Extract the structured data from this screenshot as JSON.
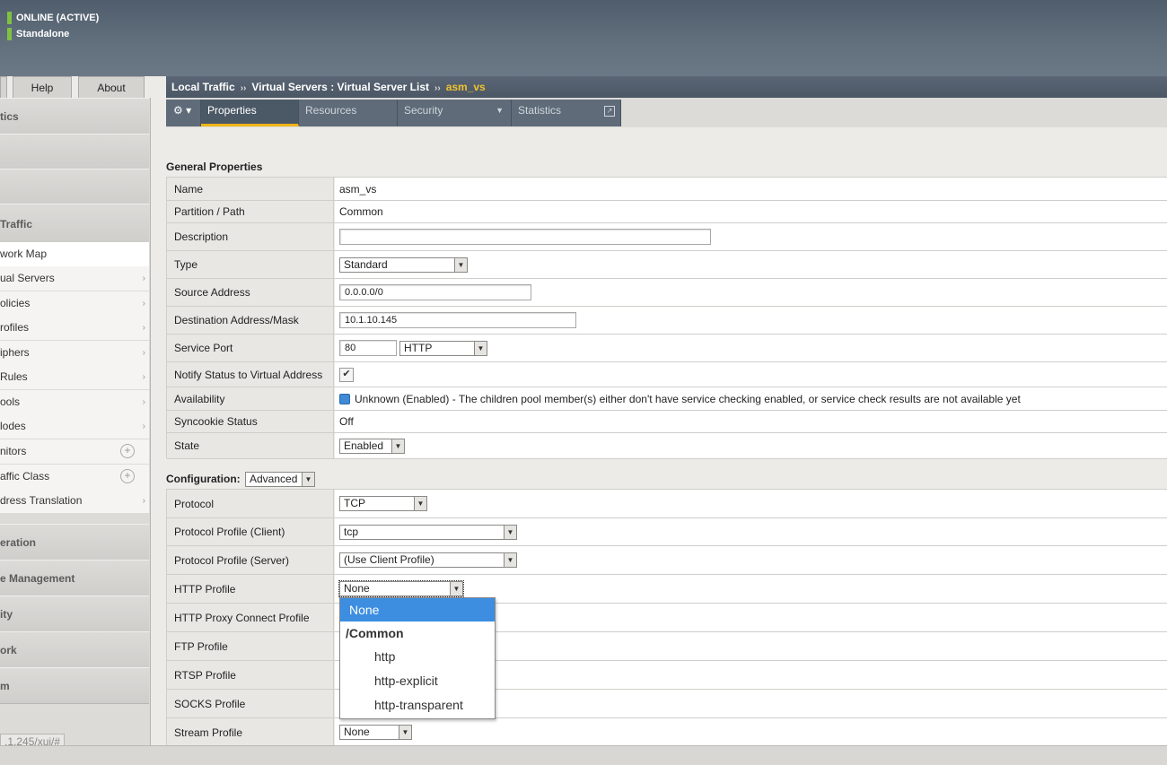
{
  "header": {
    "status_online": "ONLINE (ACTIVE)",
    "status_mode": "Standalone"
  },
  "top_tabs": {
    "help": "Help",
    "about": "About"
  },
  "sidebar": {
    "sections_top": [
      "tics",
      "",
      ""
    ],
    "traffic_header": "Traffic",
    "items": [
      {
        "label": "work Map",
        "arrow": false,
        "plus": false
      },
      {
        "label": "ual Servers",
        "arrow": true,
        "plus": false
      },
      {
        "label": "olicies",
        "arrow": true,
        "plus": false
      },
      {
        "label": "rofiles",
        "arrow": true,
        "plus": false
      },
      {
        "label": "iphers",
        "arrow": true,
        "plus": false
      },
      {
        "label": "Rules",
        "arrow": true,
        "plus": false
      },
      {
        "label": "ools",
        "arrow": true,
        "plus": false
      },
      {
        "label": "lodes",
        "arrow": true,
        "plus": false
      },
      {
        "label": "nitors",
        "arrow": false,
        "plus": true
      },
      {
        "label": "affic Class",
        "arrow": false,
        "plus": true
      },
      {
        "label": "dress Translation",
        "arrow": true,
        "plus": false
      }
    ],
    "sections_bottom": [
      "eration",
      "e Management",
      "ity",
      "ork",
      "m"
    ],
    "url_tip": ".1.245/xui/#"
  },
  "breadcrumb": {
    "part1": "Local Traffic",
    "sep": "››",
    "part2": "Virtual Servers : Virtual Server List",
    "current": "asm_vs"
  },
  "tabs": {
    "gear": "⚙ ▾",
    "properties": "Properties",
    "resources": "Resources",
    "security": "Security",
    "statistics": "Statistics"
  },
  "general": {
    "title": "General Properties",
    "name_label": "Name",
    "name_value": "asm_vs",
    "partition_label": "Partition / Path",
    "partition_value": "Common",
    "description_label": "Description",
    "description_value": "",
    "type_label": "Type",
    "type_value": "Standard",
    "source_label": "Source Address",
    "source_value": "0.0.0.0/0",
    "dest_label": "Destination Address/Mask",
    "dest_value": "10.1.10.145",
    "port_label": "Service Port",
    "port_value": "80",
    "port_service": "HTTP",
    "notify_label": "Notify Status to Virtual Address",
    "notify_checked": "✔",
    "availability_label": "Availability",
    "availability_value": "Unknown (Enabled) - The children pool member(s) either don't have service checking enabled, or service check results are not available yet",
    "syncookie_label": "Syncookie Status",
    "syncookie_value": "Off",
    "state_label": "State",
    "state_value": "Enabled"
  },
  "configuration": {
    "title": "Configuration:",
    "mode": "Advanced",
    "protocol_label": "Protocol",
    "protocol_value": "TCP",
    "client_label": "Protocol Profile (Client)",
    "client_value": "tcp",
    "server_label": "Protocol Profile (Server)",
    "server_value": "(Use Client Profile)",
    "http_label": "HTTP Profile",
    "http_value": "None",
    "proxy_label": "HTTP Proxy Connect Profile",
    "ftp_label": "FTP Profile",
    "rtsp_label": "RTSP Profile",
    "socks_label": "SOCKS Profile",
    "stream_label": "Stream Profile",
    "stream_value": "None"
  },
  "http_dropdown": {
    "options": [
      "None",
      "/Common",
      "http",
      "http-explicit",
      "http-transparent"
    ],
    "selected": "None"
  }
}
